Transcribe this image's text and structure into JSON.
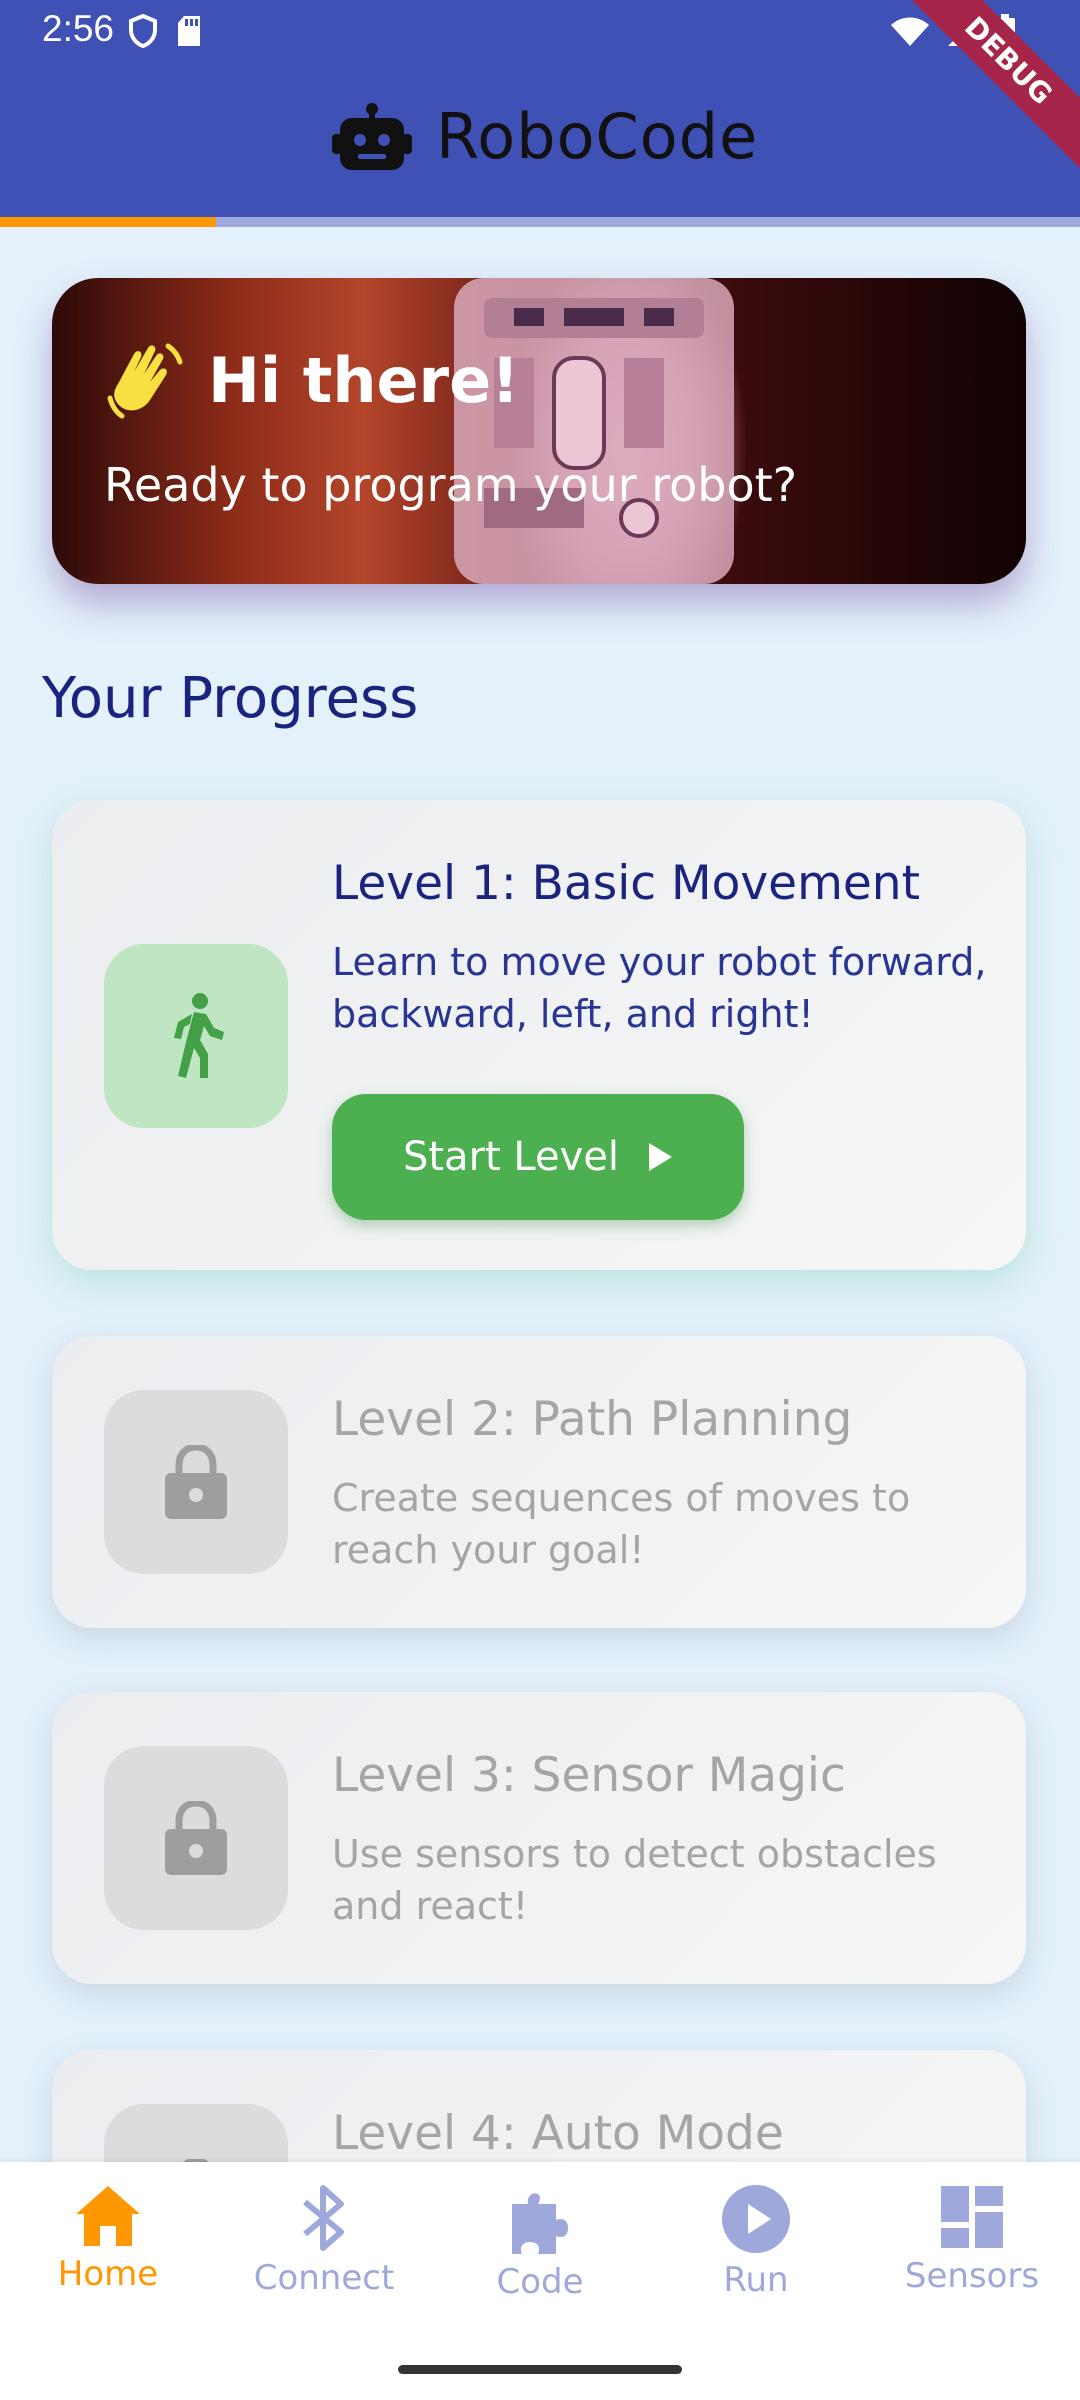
{
  "status_bar": {
    "time": "2:56"
  },
  "app_bar": {
    "title": "RoboCode",
    "debug_banner": "DEBUG"
  },
  "overall_progress": 0.2,
  "hero": {
    "title": "Hi there!",
    "subtitle": "Ready to program your robot?"
  },
  "section_title": "Your Progress",
  "levels": [
    {
      "title": "Level 1: Basic Movement",
      "description": "Learn to move your robot forward, backward, left, and right!",
      "button": "Start Level",
      "locked": false,
      "icon": "walking-person-icon"
    },
    {
      "title": "Level 2: Path Planning",
      "description": "Create sequences of moves to reach your goal!",
      "locked": true,
      "icon": "lock-icon"
    },
    {
      "title": "Level 3: Sensor Magic",
      "description": "Use sensors to detect obstacles and react!",
      "locked": true,
      "icon": "lock-icon"
    },
    {
      "title": "Level 4: Auto Mode",
      "locked": true,
      "icon": "lock-icon"
    }
  ],
  "bottom_nav": [
    {
      "label": "Home",
      "icon": "home-icon",
      "selected": true
    },
    {
      "label": "Connect",
      "icon": "bluetooth-icon",
      "selected": false
    },
    {
      "label": "Code",
      "icon": "puzzle-icon",
      "selected": false
    },
    {
      "label": "Run",
      "icon": "play-circle-icon",
      "selected": false
    },
    {
      "label": "Sensors",
      "icon": "dashboard-icon",
      "selected": false
    }
  ],
  "colors": {
    "primary": "#3f51b5",
    "accent": "#ff9800",
    "success": "#4caf50",
    "background": "#e4f1fb",
    "nav_inactive": "#9fa8da"
  }
}
